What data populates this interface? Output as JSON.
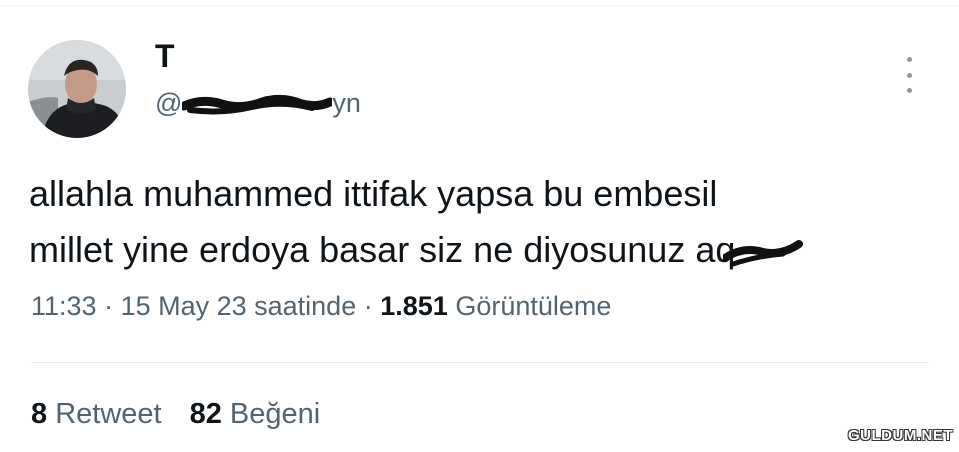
{
  "author": {
    "display_name": "T",
    "handle_prefix": "@",
    "handle_suffix": "yn",
    "avatar_icon": "profile-photo-icon"
  },
  "tweet": {
    "line1": "allahla muhammed ittifak yapsa bu embesil",
    "line2": "millet yine erdoya basar siz ne diyosunuz",
    "line2_tail": "aq"
  },
  "meta": {
    "time": "11:33",
    "sep1": " · ",
    "date": "15 May 23 saatinde",
    "sep2": " · ",
    "views_count": "1.851",
    "views_label": "Görüntüleme"
  },
  "stats": {
    "retweet_count": "8",
    "retweet_label": "Retweet",
    "like_count": "82",
    "like_label": "Beğeni"
  },
  "watermark": "GULDUM.NET",
  "colors": {
    "text_primary": "#0f1419",
    "text_secondary": "#536471",
    "divider": "#eff3f4"
  }
}
